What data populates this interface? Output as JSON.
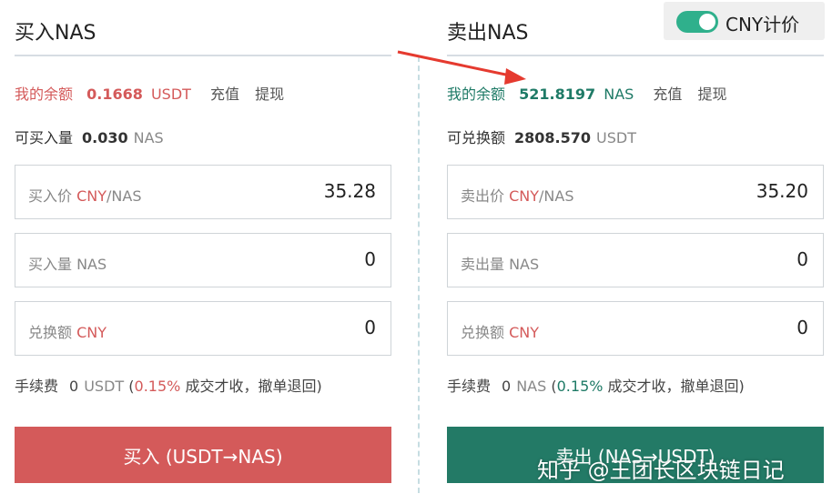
{
  "toggle": {
    "label": "CNY计价",
    "on": true,
    "color": "#2fb08c"
  },
  "buy": {
    "title": "买入NAS",
    "balance_label": "我的余额",
    "balance_value": "0.1668",
    "balance_unit": "USDT",
    "recharge": "充值",
    "withdraw": "提现",
    "avail_label": "可买入量",
    "avail_value": "0.030",
    "avail_unit": "NAS",
    "price_label": "买入价",
    "price_unit": "CNY",
    "price_unit_suffix": "/NAS",
    "price_value": "35.28",
    "amount_label": "买入量 NAS",
    "amount_value": "0",
    "exchange_label": "兑换额",
    "exchange_unit": "CNY",
    "exchange_value": "0",
    "fee_label": "手续费",
    "fee_value": "0",
    "fee_unit": "USDT",
    "fee_open": "(",
    "fee_rate": "0.15%",
    "fee_note": "成交才收，撤单退回)",
    "button": "买入 (USDT→NAS)",
    "color": "#d45a5a"
  },
  "sell": {
    "title": "卖出NAS",
    "balance_label": "我的余额",
    "balance_value": "521.8197",
    "balance_unit": "NAS",
    "recharge": "充值",
    "withdraw": "提现",
    "avail_label": "可兑换额",
    "avail_value": "2808.570",
    "avail_unit": "USDT",
    "price_label": "卖出价",
    "price_unit": "CNY",
    "price_unit_suffix": "/NAS",
    "price_value": "35.20",
    "amount_label": "卖出量 NAS",
    "amount_value": "0",
    "exchange_label": "兑换额",
    "exchange_unit": "CNY",
    "exchange_value": "0",
    "fee_label": "手续费",
    "fee_value": "0",
    "fee_unit": "NAS",
    "fee_open": "(",
    "fee_rate": "0.15%",
    "fee_note": "成交才收，撤单退回)",
    "button": "卖出 (NAS→USDT)",
    "color": "#237a66"
  },
  "watermark": "知乎 @王团长区块链日记",
  "arrow_color": "#e53a2f"
}
